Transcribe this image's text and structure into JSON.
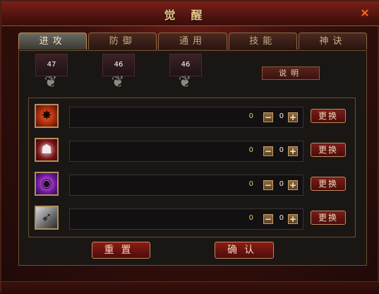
{
  "window": {
    "title": "觉醒",
    "close_icon": "close-icon"
  },
  "tabs": [
    {
      "label": "进攻",
      "active": true
    },
    {
      "label": "防御",
      "active": false
    },
    {
      "label": "通用",
      "active": false
    },
    {
      "label": "技能",
      "active": false
    },
    {
      "label": "神诀",
      "active": false
    }
  ],
  "stats": [
    {
      "value": "47"
    },
    {
      "value": "46"
    },
    {
      "value": "46"
    }
  ],
  "explain_button": "说明",
  "rows": [
    {
      "icon": "red-swirl-skill-icon",
      "value": "0",
      "count": "0",
      "swap_label": "更换"
    },
    {
      "icon": "hooded-figure-skill-icon",
      "value": "0",
      "count": "0",
      "swap_label": "更换"
    },
    {
      "icon": "purple-orb-skill-icon",
      "value": "0",
      "count": "0",
      "swap_label": "更换"
    },
    {
      "icon": "arrow-skill-icon",
      "value": "0",
      "count": "0",
      "swap_label": "更换"
    }
  ],
  "buttons": {
    "reset": "重置",
    "confirm": "确认"
  },
  "colors": {
    "accent_gold": "#e9c46a",
    "button_red": "#7a1c18",
    "border_bronze": "#b09060"
  }
}
